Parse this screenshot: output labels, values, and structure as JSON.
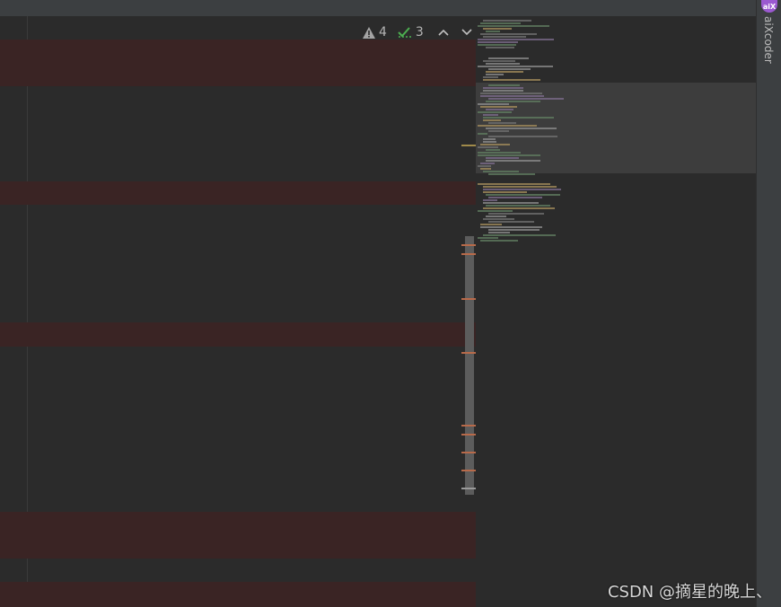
{
  "inspection": {
    "warnings_count": "4",
    "weak_warnings_count": "3",
    "prev_label": "^",
    "next_label": "v"
  },
  "plugin": {
    "name": "aiXcoder",
    "icon_text": "aiX"
  },
  "watermark": "CSDN @摘星的晚上、",
  "colors": {
    "editor_bg": "#2b2b2b",
    "highlight_row": "#3a2424",
    "warning_mark": "#b86a4a",
    "panel_bg": "#3c3f41"
  }
}
